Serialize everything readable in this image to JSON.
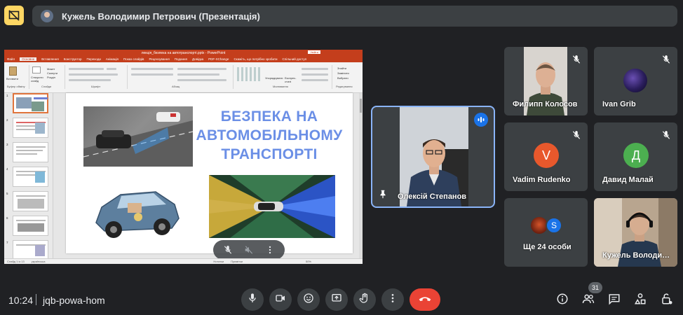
{
  "header": {
    "presenter_title": "Кужель Володимир Петрович (Презентація)"
  },
  "powerpoint": {
    "window_title": "лекція_безпека на автотранспорті.pptx - PowerPoint",
    "sign_in": "Увійти",
    "tabs": [
      "Файл",
      "Основне",
      "Вставлення",
      "Конструктор",
      "Переходи",
      "Анімація",
      "Показ слайдів",
      "Рецензування",
      "Подання",
      "Довідка",
      "PDF-XChange",
      "Скажіть, що потрібно зробити",
      "Спільний доступ"
    ],
    "active_tab_index": 1,
    "ribbon_groups": [
      "Буфер обміну",
      "Слайди",
      "Шрифт",
      "Абзац",
      "Малювання",
      "Редагування"
    ],
    "ribbon_buttons": {
      "paste": "Вставити",
      "new_slide": "Створити слайд",
      "layout": "Макет",
      "reset": "Скинути",
      "section": "Розділ",
      "arrange": "Упорядкувати",
      "quick_styles": "Експрес-стилі",
      "find": "Знайти",
      "replace": "Замінити",
      "select": "Вибрати"
    },
    "thumbnail_numbers": [
      "1",
      "2",
      "3",
      "4",
      "5",
      "6",
      "7"
    ],
    "active_thumbnail": 0,
    "slide_title": "БЕЗПЕКА НА АВТОМОБІЛЬНОМУ ТРАНСПОРТІ",
    "status": {
      "slide_counter": "Слайд 1 із 13",
      "language": "українська",
      "notes": "Нотатки",
      "comments": "Примітки",
      "zoom": "50%"
    }
  },
  "overlay_controls": [
    "mic-off-icon",
    "volume-off-icon",
    "more-vert-icon"
  ],
  "speaker": {
    "name": "Олексій Степанов",
    "speaking": true
  },
  "participants": [
    {
      "name": "Филипп Колосов",
      "type": "video",
      "muted": true
    },
    {
      "name": "Ivan Grib",
      "type": "avatar-image",
      "muted": true
    },
    {
      "name": "Vadim Rudenko",
      "type": "letter",
      "letter": "V",
      "color": "#e8582c",
      "muted": true
    },
    {
      "name": "Давид Малай",
      "type": "letter",
      "letter": "Д",
      "color": "#4caf50",
      "muted": true
    },
    {
      "name": "Ще 24 особи",
      "type": "group",
      "letter": "S",
      "color": "#1a73e8"
    },
    {
      "name": "Кужель Володи…",
      "type": "video"
    }
  ],
  "bottom_bar": {
    "time": "10:24",
    "meeting_code": "jqb-powa-hom",
    "participant_count": "31",
    "controls": [
      "mic-icon",
      "camera-icon",
      "emoji-icon",
      "present-icon",
      "raise-hand-icon",
      "more-options-icon",
      "end-call-icon"
    ],
    "right_controls": [
      "info-icon",
      "people-icon",
      "chat-icon",
      "activities-icon",
      "host-controls-icon"
    ]
  },
  "colors": {
    "background": "#202124",
    "tile": "#3c4043",
    "accent": "#8ab4f8",
    "end_call": "#ea4335",
    "present_badge": "#fdd663",
    "ppt_brand": "#c43e1c",
    "slide_title": "#6b8fe6"
  }
}
